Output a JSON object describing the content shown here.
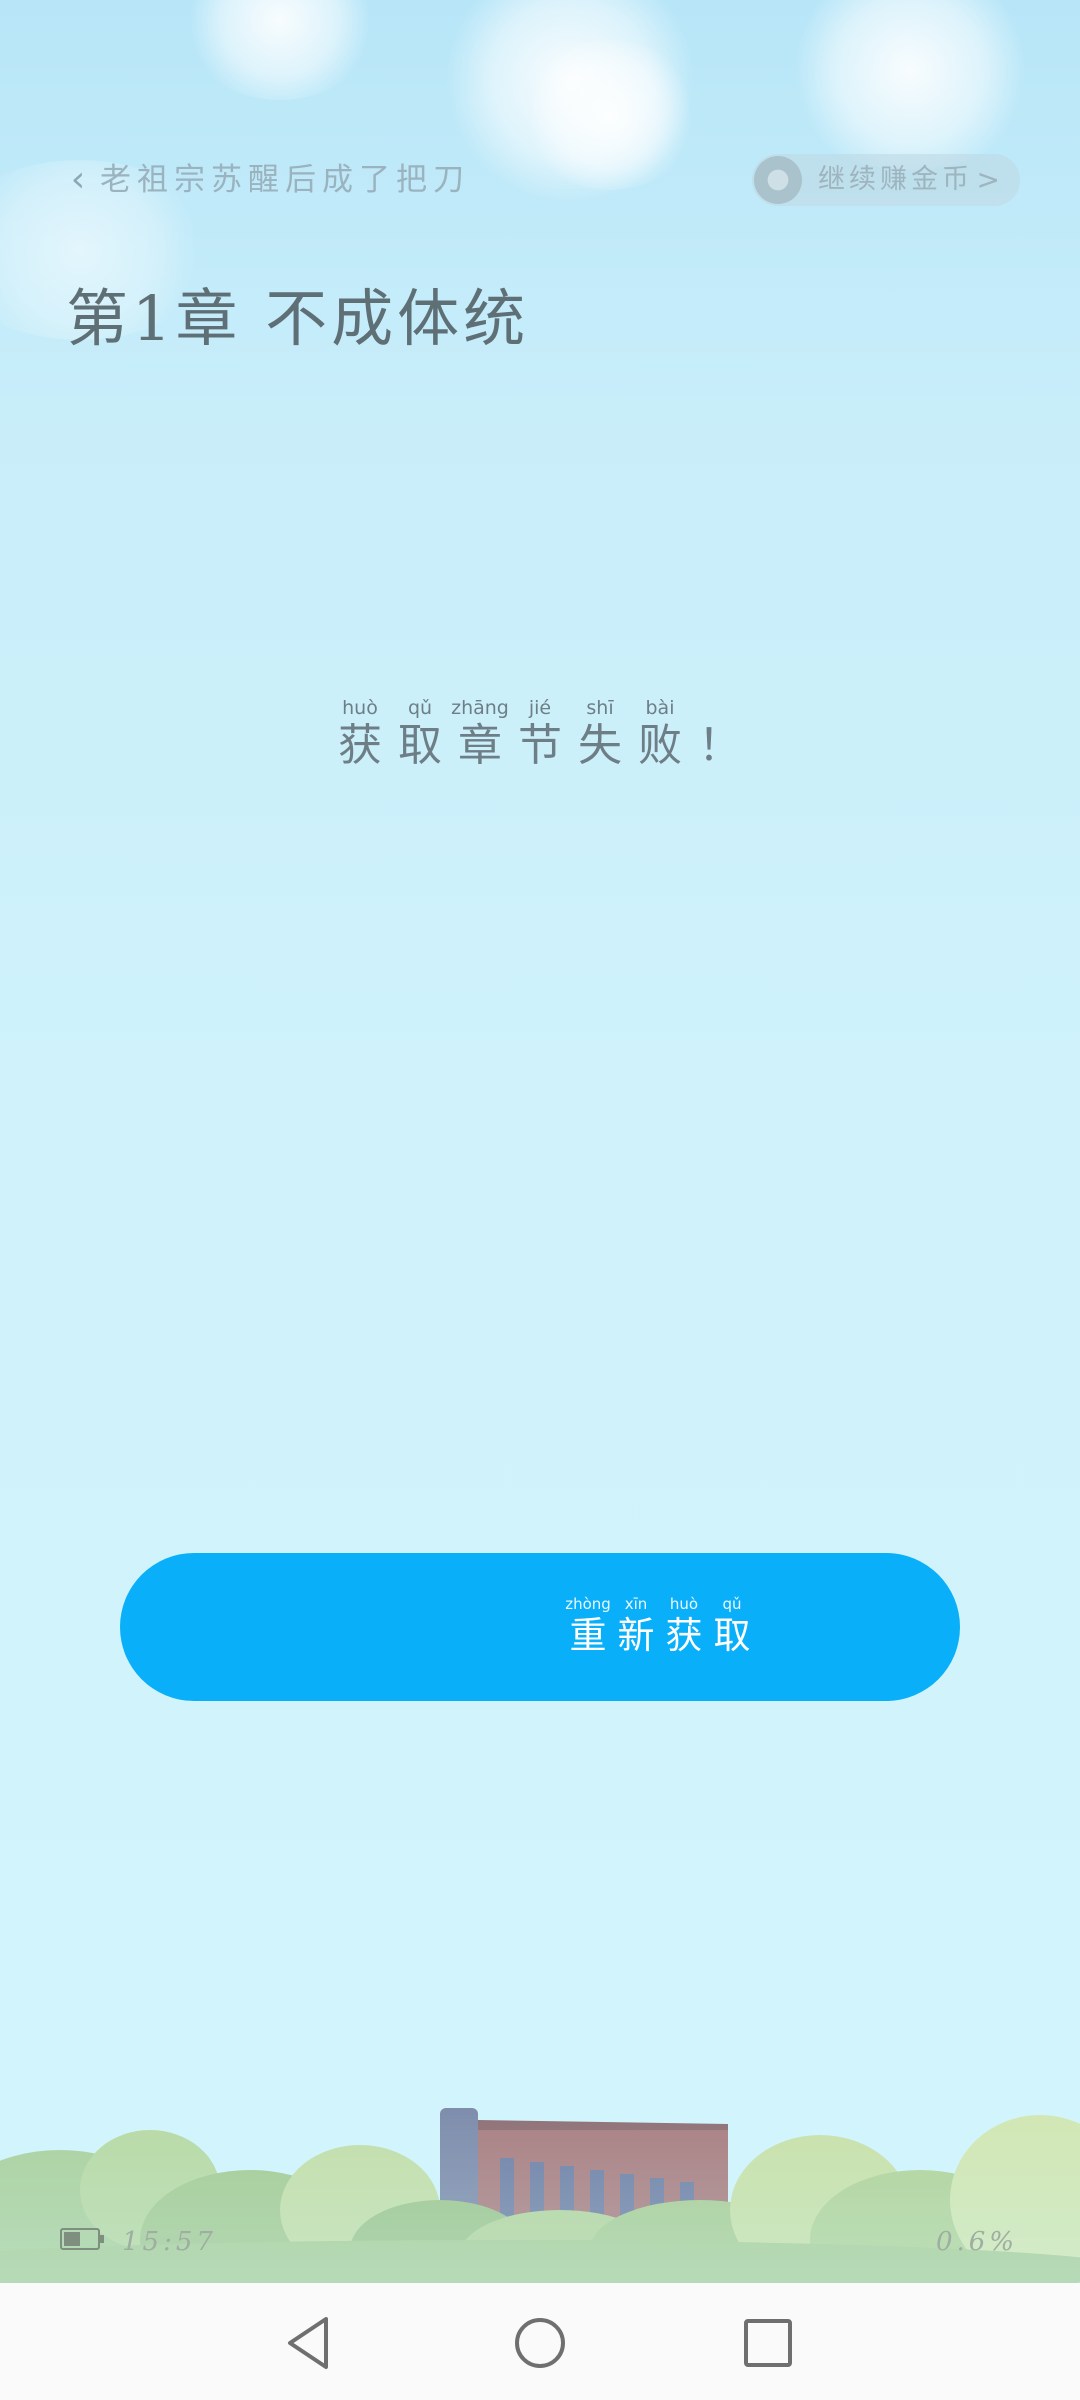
{
  "header": {
    "book_title": "老祖宗苏醒后成了把刀",
    "coin_button_label": "继续赚金币",
    "coin_arrow": ">"
  },
  "chapter": {
    "title": "第1章 不成体统"
  },
  "error": {
    "chars": [
      {
        "pinyin": "huò",
        "hanzi": "获"
      },
      {
        "pinyin": "qǔ",
        "hanzi": "取"
      },
      {
        "pinyin": "zhāng",
        "hanzi": "章"
      },
      {
        "pinyin": "jié",
        "hanzi": "节"
      },
      {
        "pinyin": "shī",
        "hanzi": "失"
      },
      {
        "pinyin": "bài",
        "hanzi": "败"
      },
      {
        "pinyin": "",
        "hanzi": "！"
      }
    ]
  },
  "retry_button": {
    "chars": [
      {
        "pinyin": "zhòng",
        "hanzi": "重"
      },
      {
        "pinyin": "xīn",
        "hanzi": "新"
      },
      {
        "pinyin": "huò",
        "hanzi": "获"
      },
      {
        "pinyin": "qǔ",
        "hanzi": "取"
      }
    ]
  },
  "footer": {
    "time": "15:57",
    "progress": "0.6%"
  },
  "colors": {
    "accent": "#0aaffa",
    "background": "#cff2fb",
    "text": "#6e7e86"
  },
  "icons": {
    "back": "chevron-left-icon",
    "coin": "coin-icon",
    "battery": "battery-icon",
    "nav_back": "triangle-back-icon",
    "nav_home": "circle-home-icon",
    "nav_recents": "square-recents-icon"
  }
}
